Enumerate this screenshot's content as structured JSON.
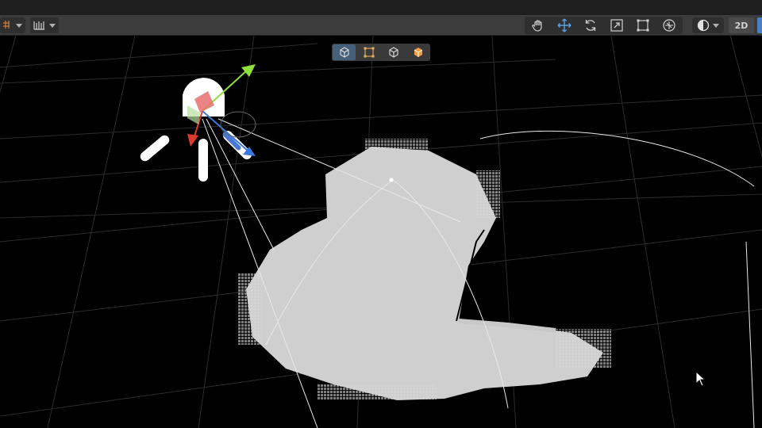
{
  "toolbar": {
    "left": [
      {
        "name": "snap-settings-dropdown",
        "icon": "snap-grid-icon"
      },
      {
        "name": "increment-snap-dropdown",
        "icon": "ruler-icon"
      }
    ],
    "tools": [
      {
        "name": "hand-tool",
        "icon": "hand-icon",
        "active": false
      },
      {
        "name": "move-tool",
        "icon": "move-arrows-icon",
        "active": true
      },
      {
        "name": "rotate-tool",
        "icon": "rotate-icon",
        "active": false
      },
      {
        "name": "scale-tool",
        "icon": "scale-icon",
        "active": false
      },
      {
        "name": "rect-tool",
        "icon": "rect-transform-icon",
        "active": false
      },
      {
        "name": "transform-tool",
        "icon": "transform-icon",
        "active": false
      }
    ],
    "shading_icon": "shading-mode-icon",
    "mode_2d_label": "2D"
  },
  "overlay": {
    "buttons": [
      {
        "name": "overlay-box-button",
        "icon": "cube-icon",
        "selected": true
      },
      {
        "name": "overlay-rect-button",
        "icon": "rect-icon",
        "selected": false
      },
      {
        "name": "overlay-cube-button",
        "icon": "cube-outline-icon",
        "selected": false
      },
      {
        "name": "overlay-orange-cube-button",
        "icon": "orange-cube-icon",
        "selected": false
      }
    ]
  },
  "colors": {
    "accent": "#4a7fc1",
    "axis_x": "#e03a2f",
    "axis_y": "#8fe03a",
    "axis_z": "#3a78e0",
    "point_cloud": "#cfcfcf",
    "grid": "#2f2f2f"
  }
}
